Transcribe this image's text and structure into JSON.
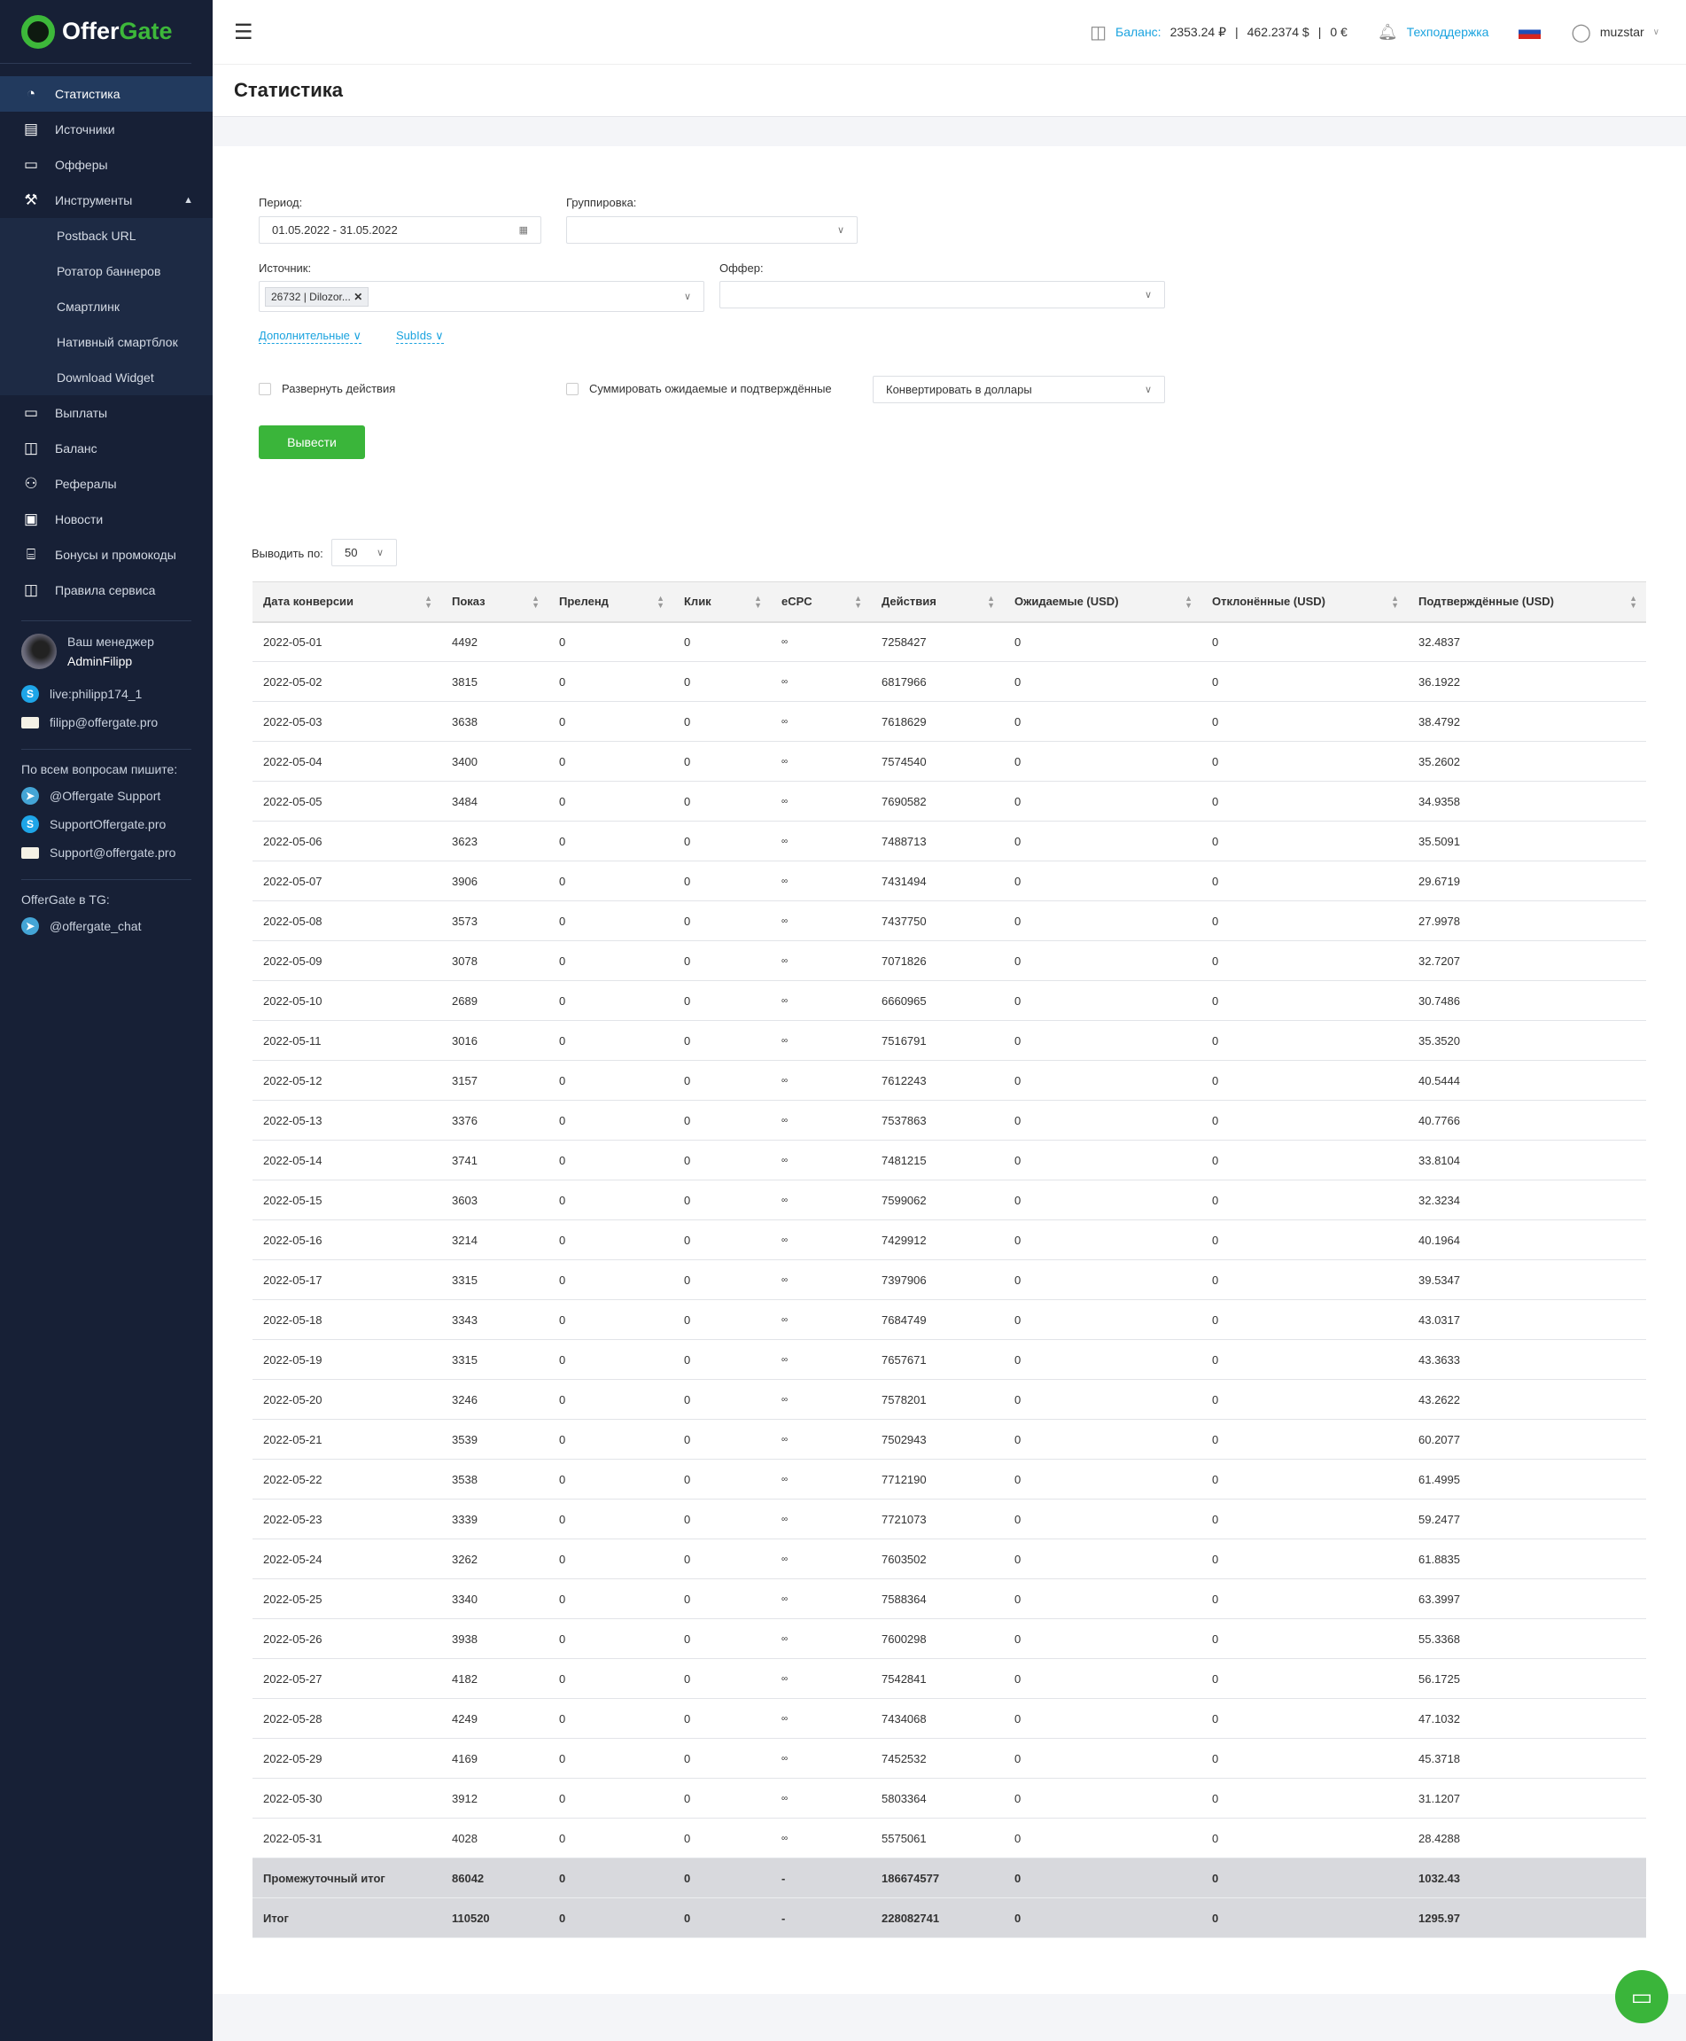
{
  "brand": {
    "name_a": "Offer",
    "name_b": "Gate"
  },
  "sidebar": {
    "items": [
      {
        "label": "Статистика",
        "icon": "pie-chart-icon",
        "active": true
      },
      {
        "label": "Источники",
        "icon": "window-icon"
      },
      {
        "label": "Офферы",
        "icon": "briefcase-icon"
      },
      {
        "label": "Инструменты",
        "icon": "wrench-icon"
      }
    ],
    "sub": [
      "Postback URL",
      "Ротатор баннеров",
      "Смартлинк",
      "Нативный смартблок",
      "Download Widget"
    ],
    "items2": [
      {
        "label": "Выплаты",
        "icon": "card-icon"
      },
      {
        "label": "Баланс",
        "icon": "wallet-icon"
      },
      {
        "label": "Рефералы",
        "icon": "users-icon"
      },
      {
        "label": "Новости",
        "icon": "news-icon"
      },
      {
        "label": "Бонусы и промокоды",
        "icon": "gift-icon"
      },
      {
        "label": "Правила сервиса",
        "icon": "book-icon"
      }
    ],
    "manager_label": "Ваш менеджер",
    "manager_name": "AdminFilipp",
    "manager_skype": "live:philipp174_1",
    "manager_email": "filipp@offergate.pro",
    "support_label": "По всем вопросам пишите:",
    "support_tg": "@Offergate Support",
    "support_skype": "SupportOffergate.pro",
    "support_email": "Support@offergate.pro",
    "tg_label": "OfferGate в TG:",
    "tg_chat": "@offergate_chat"
  },
  "header": {
    "balance_label": "Баланс:",
    "rub": "2353.24 ₽",
    "usd": "462.2374 $",
    "eur": "0 €",
    "support": "Техподдержка",
    "user": "muzstar",
    "sep": "|"
  },
  "page_title": "Статистика",
  "filters": {
    "period_label": "Период:",
    "period_value": "01.05.2022 - 31.05.2022",
    "group_label": "Группировка:",
    "source_label": "Источник:",
    "source_tag": "26732 | Dilozor...",
    "offer_label": "Оффер:",
    "extra_link": "Дополнительные",
    "subids_link": "SubIds",
    "expand_actions": "Развернуть действия",
    "sum_pending": "Суммировать ожидаемые и подтверждённые",
    "convert": "Конвертировать в доллары",
    "submit": "Вывести",
    "per_page_label": "Выводить по:",
    "per_page": "50"
  },
  "table": {
    "columns": [
      "Дата конверсии",
      "Показ",
      "Преленд",
      "Клик",
      "eCPC",
      "Действия",
      "Ожидаемые (USD)",
      "Отклонённые (USD)",
      "Подтверждённые (USD)"
    ],
    "rows": [
      [
        "2022-05-01",
        "4492",
        "0",
        "0",
        "∞",
        "7258427",
        "0",
        "0",
        "32.4837"
      ],
      [
        "2022-05-02",
        "3815",
        "0",
        "0",
        "∞",
        "6817966",
        "0",
        "0",
        "36.1922"
      ],
      [
        "2022-05-03",
        "3638",
        "0",
        "0",
        "∞",
        "7618629",
        "0",
        "0",
        "38.4792"
      ],
      [
        "2022-05-04",
        "3400",
        "0",
        "0",
        "∞",
        "7574540",
        "0",
        "0",
        "35.2602"
      ],
      [
        "2022-05-05",
        "3484",
        "0",
        "0",
        "∞",
        "7690582",
        "0",
        "0",
        "34.9358"
      ],
      [
        "2022-05-06",
        "3623",
        "0",
        "0",
        "∞",
        "7488713",
        "0",
        "0",
        "35.5091"
      ],
      [
        "2022-05-07",
        "3906",
        "0",
        "0",
        "∞",
        "7431494",
        "0",
        "0",
        "29.6719"
      ],
      [
        "2022-05-08",
        "3573",
        "0",
        "0",
        "∞",
        "7437750",
        "0",
        "0",
        "27.9978"
      ],
      [
        "2022-05-09",
        "3078",
        "0",
        "0",
        "∞",
        "7071826",
        "0",
        "0",
        "32.7207"
      ],
      [
        "2022-05-10",
        "2689",
        "0",
        "0",
        "∞",
        "6660965",
        "0",
        "0",
        "30.7486"
      ],
      [
        "2022-05-11",
        "3016",
        "0",
        "0",
        "∞",
        "7516791",
        "0",
        "0",
        "35.3520"
      ],
      [
        "2022-05-12",
        "3157",
        "0",
        "0",
        "∞",
        "7612243",
        "0",
        "0",
        "40.5444"
      ],
      [
        "2022-05-13",
        "3376",
        "0",
        "0",
        "∞",
        "7537863",
        "0",
        "0",
        "40.7766"
      ],
      [
        "2022-05-14",
        "3741",
        "0",
        "0",
        "∞",
        "7481215",
        "0",
        "0",
        "33.8104"
      ],
      [
        "2022-05-15",
        "3603",
        "0",
        "0",
        "∞",
        "7599062",
        "0",
        "0",
        "32.3234"
      ],
      [
        "2022-05-16",
        "3214",
        "0",
        "0",
        "∞",
        "7429912",
        "0",
        "0",
        "40.1964"
      ],
      [
        "2022-05-17",
        "3315",
        "0",
        "0",
        "∞",
        "7397906",
        "0",
        "0",
        "39.5347"
      ],
      [
        "2022-05-18",
        "3343",
        "0",
        "0",
        "∞",
        "7684749",
        "0",
        "0",
        "43.0317"
      ],
      [
        "2022-05-19",
        "3315",
        "0",
        "0",
        "∞",
        "7657671",
        "0",
        "0",
        "43.3633"
      ],
      [
        "2022-05-20",
        "3246",
        "0",
        "0",
        "∞",
        "7578201",
        "0",
        "0",
        "43.2622"
      ],
      [
        "2022-05-21",
        "3539",
        "0",
        "0",
        "∞",
        "7502943",
        "0",
        "0",
        "60.2077"
      ],
      [
        "2022-05-22",
        "3538",
        "0",
        "0",
        "∞",
        "7712190",
        "0",
        "0",
        "61.4995"
      ],
      [
        "2022-05-23",
        "3339",
        "0",
        "0",
        "∞",
        "7721073",
        "0",
        "0",
        "59.2477"
      ],
      [
        "2022-05-24",
        "3262",
        "0",
        "0",
        "∞",
        "7603502",
        "0",
        "0",
        "61.8835"
      ],
      [
        "2022-05-25",
        "3340",
        "0",
        "0",
        "∞",
        "7588364",
        "0",
        "0",
        "63.3997"
      ],
      [
        "2022-05-26",
        "3938",
        "0",
        "0",
        "∞",
        "7600298",
        "0",
        "0",
        "55.3368"
      ],
      [
        "2022-05-27",
        "4182",
        "0",
        "0",
        "∞",
        "7542841",
        "0",
        "0",
        "56.1725"
      ],
      [
        "2022-05-28",
        "4249",
        "0",
        "0",
        "∞",
        "7434068",
        "0",
        "0",
        "47.1032"
      ],
      [
        "2022-05-29",
        "4169",
        "0",
        "0",
        "∞",
        "7452532",
        "0",
        "0",
        "45.3718"
      ],
      [
        "2022-05-30",
        "3912",
        "0",
        "0",
        "∞",
        "5803364",
        "0",
        "0",
        "31.1207"
      ],
      [
        "2022-05-31",
        "4028",
        "0",
        "0",
        "∞",
        "5575061",
        "0",
        "0",
        "28.4288"
      ]
    ],
    "totals": [
      [
        "Промежуточный итог",
        "86042",
        "0",
        "0",
        "-",
        "186674577",
        "0",
        "0",
        "1032.43"
      ],
      [
        "Итог",
        "110520",
        "0",
        "0",
        "-",
        "228082741",
        "0",
        "0",
        "1295.97"
      ]
    ]
  }
}
